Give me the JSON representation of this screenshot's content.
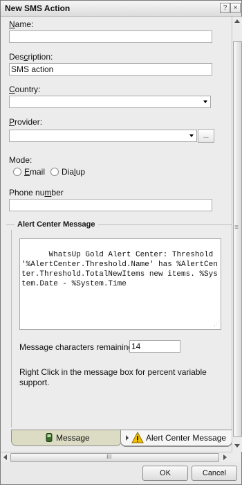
{
  "window": {
    "title": "New SMS Action",
    "help_glyph": "?",
    "close_glyph": "×"
  },
  "form": {
    "name_label_u": "N",
    "name_label_rest": "ame:",
    "name_value": "",
    "description_label_pre": "Des",
    "description_label_u": "c",
    "description_label_rest": "ription:",
    "description_value": "SMS action",
    "country_label_u": "C",
    "country_label_rest": "ountry:",
    "country_value": "",
    "provider_label_u": "P",
    "provider_label_rest": "rovider:",
    "provider_value": "",
    "provider_browse_label": "...",
    "mode_label": "Mode:",
    "mode_email_u": "E",
    "mode_email_rest": "mail",
    "mode_dialup_pre": "Dia",
    "mode_dialup_u": "l",
    "mode_dialup_rest": "up",
    "phone_label_pre": "Phone nu",
    "phone_label_u": "m",
    "phone_label_rest": "ber",
    "phone_value": ""
  },
  "alert_center": {
    "group_title": "Alert Center Message",
    "message": "WhatsUp Gold Alert Center: Threshold '%AlertCenter.Threshold.Name' has %AlertCenter.Threshold.TotalNewItems new items. %System.Date - %System.Time",
    "remaining_label": "Message characters remaining",
    "remaining_value": "14",
    "hint": "Right Click in the message box for percent variable support."
  },
  "tabs": {
    "message_label": "Message",
    "alert_center_label": "Alert Center Message"
  },
  "scrollbar": {
    "h_thumb_grip": "III",
    "v_thumb_grip": "≡"
  },
  "buttons": {
    "ok_label": "OK",
    "cancel_label": "Cancel"
  }
}
